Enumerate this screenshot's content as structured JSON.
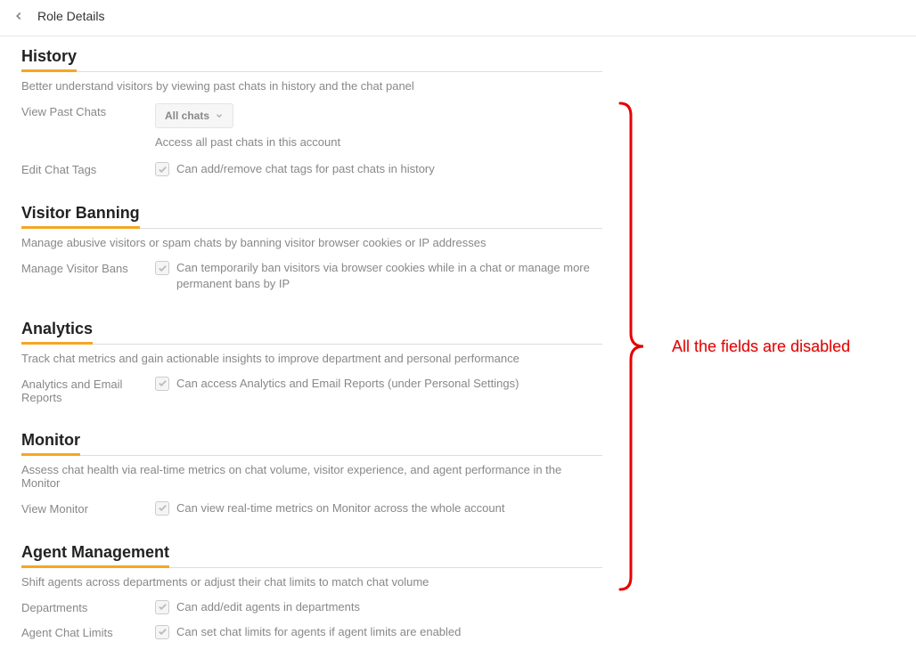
{
  "header": {
    "title": "Role Details"
  },
  "sections": {
    "history": {
      "title": "History",
      "desc": "Better understand visitors by viewing past chats in history and the chat panel",
      "view_past_chats": {
        "label": "View Past Chats",
        "value": "All chats",
        "helper": "Access all past chats in this account"
      },
      "edit_chat_tags": {
        "label": "Edit Chat Tags",
        "desc": "Can add/remove chat tags for past chats in history"
      }
    },
    "visitor_banning": {
      "title": "Visitor Banning",
      "desc": "Manage abusive visitors or spam chats by banning visitor browser cookies or IP addresses",
      "manage_bans": {
        "label": "Manage Visitor Bans",
        "desc": "Can temporarily ban visitors via browser cookies while in a chat or manage more permanent bans by IP"
      }
    },
    "analytics": {
      "title": "Analytics",
      "desc": "Track chat metrics and gain actionable insights to improve department and personal performance",
      "reports": {
        "label": "Analytics and Email Reports",
        "desc": "Can access Analytics and Email Reports (under Personal Settings)"
      }
    },
    "monitor": {
      "title": "Monitor",
      "desc": "Assess chat health via real-time metrics on chat volume, visitor experience, and agent performance in the Monitor",
      "view_monitor": {
        "label": "View Monitor",
        "desc": "Can view real-time metrics on Monitor across the whole account"
      }
    },
    "agent_mgmt": {
      "title": "Agent Management",
      "desc": "Shift agents across departments or adjust their chat limits to match chat volume",
      "departments": {
        "label": "Departments",
        "desc": "Can add/edit agents in departments"
      },
      "chat_limits": {
        "label": "Agent Chat Limits",
        "desc": "Can set chat limits for agents if agent limits are enabled"
      }
    }
  },
  "annotation": "All the fields are disabled"
}
